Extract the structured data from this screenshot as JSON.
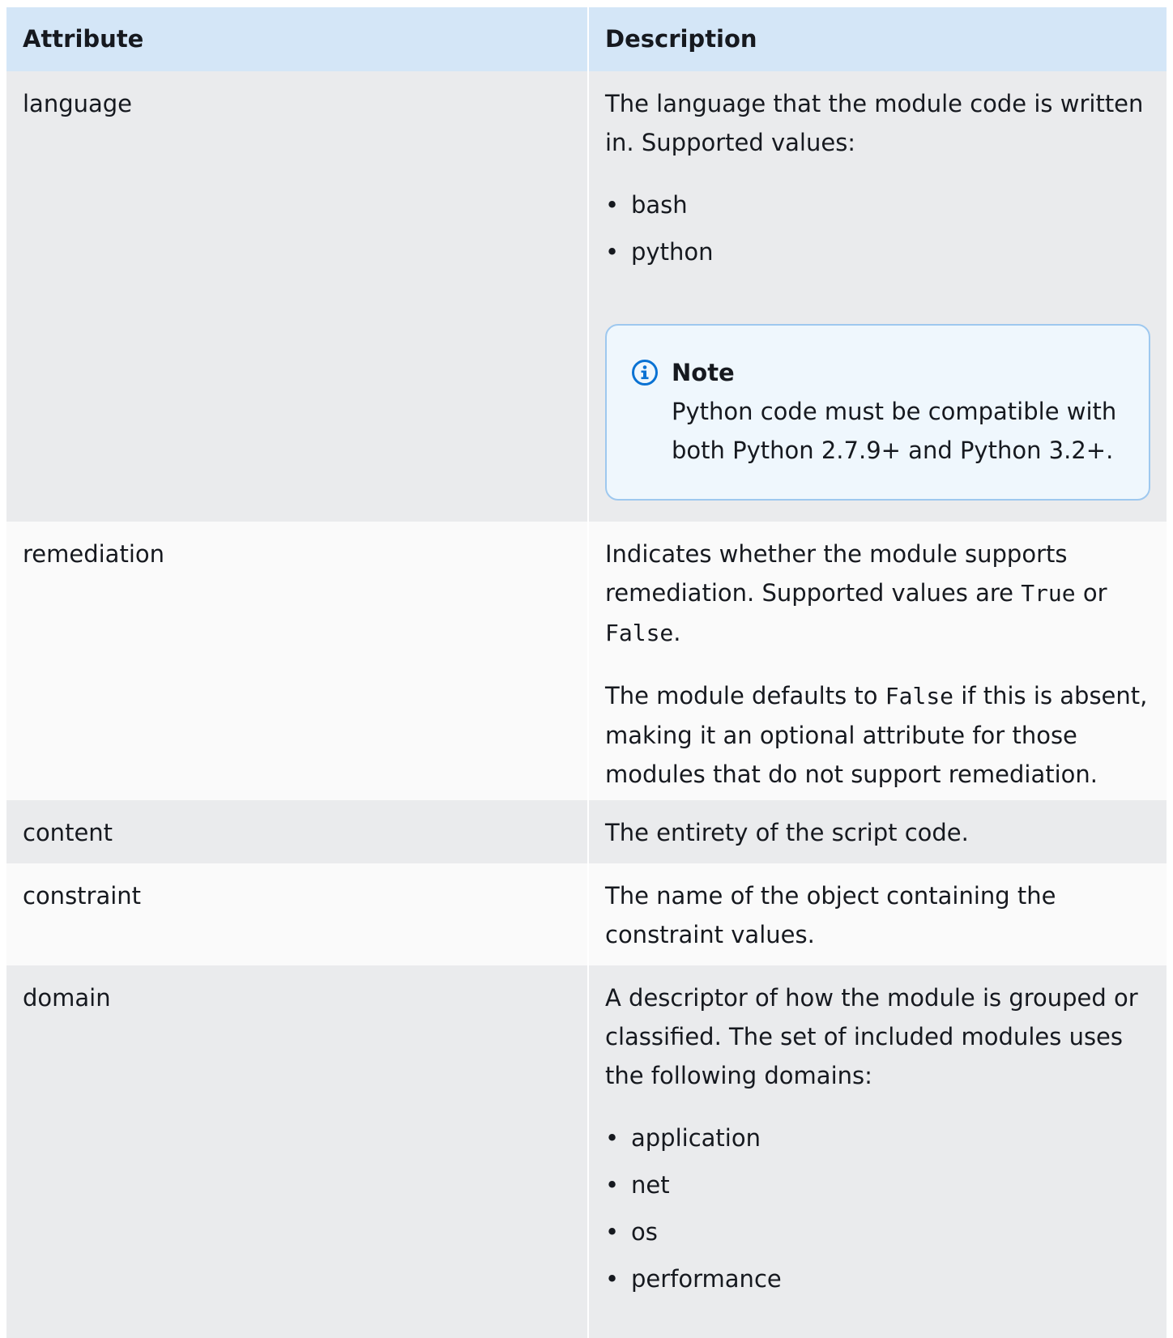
{
  "table": {
    "header": {
      "attribute": "Attribute",
      "description": "Description"
    },
    "rows": [
      {
        "attribute": "language",
        "desc_intro": "The language that the module code is written in. Supported values:",
        "values": [
          "bash",
          "python"
        ],
        "note": {
          "title": "Note",
          "body": "Python code must be compatible with both Python 2.7.9+ and Python 3.2+.",
          "icon": "info-icon"
        }
      },
      {
        "attribute": "remediation",
        "p1_prefix": "Indicates whether the module supports remediation. Supported values are ",
        "p1_code1": "True",
        "p1_mid": " or ",
        "p1_code2": "False",
        "p1_suffix": ".",
        "p2_prefix": "The module defaults to ",
        "p2_code": "False",
        "p2_suffix": " if this is absent, making it an optional attribute for those modules that do not support remediation."
      },
      {
        "attribute": "content",
        "description": "The entirety of the script code."
      },
      {
        "attribute": "constraint",
        "description": "The name of the object containing the constraint values."
      },
      {
        "attribute": "domain",
        "desc_intro": "A descriptor of how the module is grouped or classified. The set of included modules uses the following domains:",
        "values": [
          "application",
          "net",
          "os",
          "performance"
        ]
      }
    ]
  },
  "colors": {
    "header_bg": "#d4e6f7",
    "row_gray": "#eaebed",
    "row_white": "#fafafa",
    "note_border": "#9ec8ef",
    "note_bg": "#eff7fd",
    "info_icon": "#0972d3"
  }
}
